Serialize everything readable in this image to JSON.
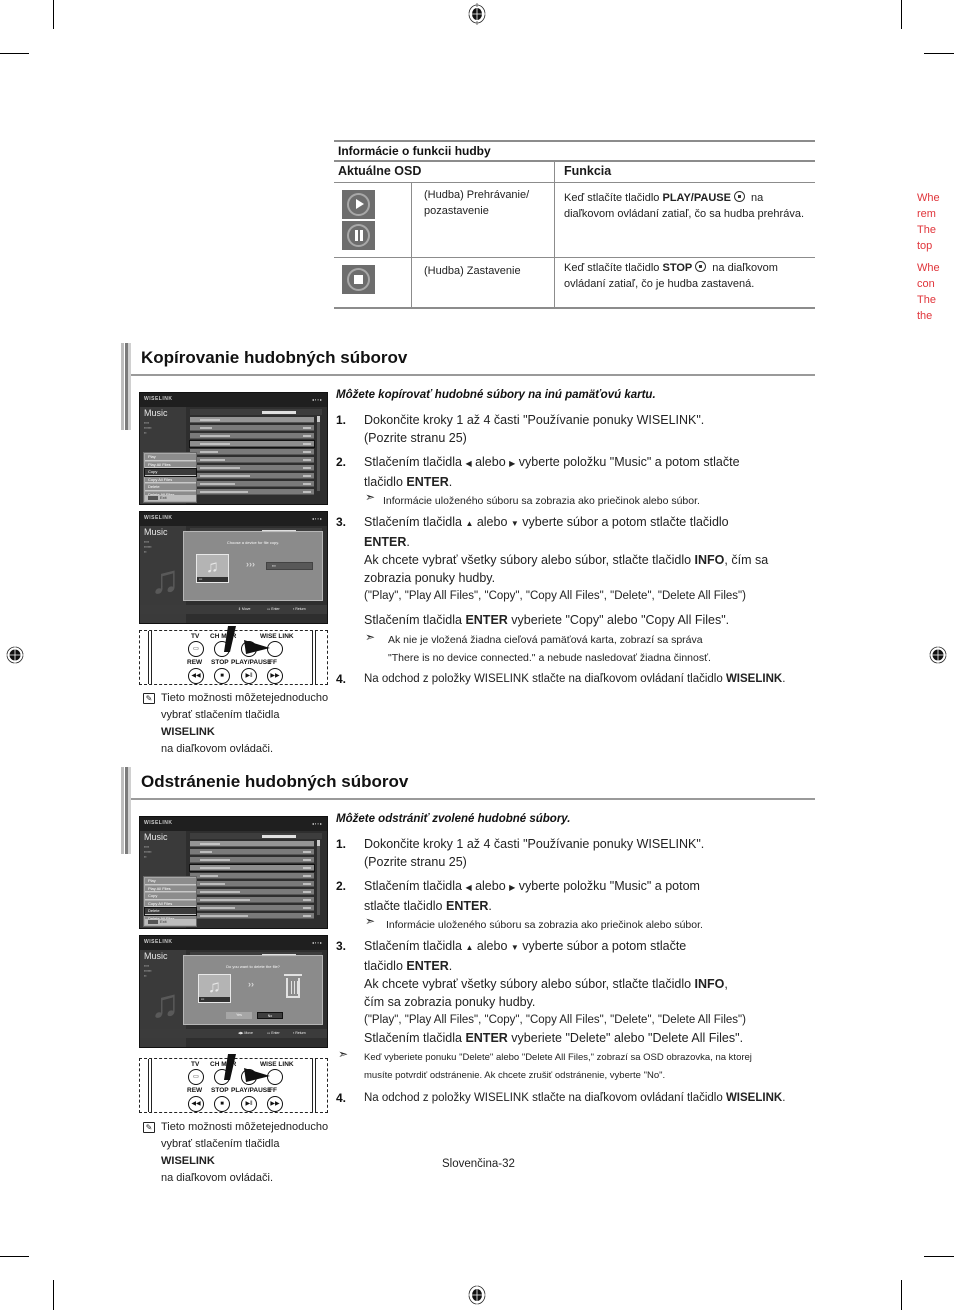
{
  "function_table": {
    "title": "Informácie o funkcii hudby",
    "col_osd": "Aktuálne OSD",
    "col_function": "Funkcia",
    "rows": [
      {
        "icons": [
          "play-icon",
          "pause-icon"
        ],
        "osd": "(Hudba) Prehrávanie/ pozastavenie",
        "osd_line1": "(Hudba) Prehrávanie/",
        "osd_line2": "pozastavenie",
        "func_pre": "Keď stlačíte tlačidlo ",
        "func_key": "PLAY/PAUSE",
        "func_post1": " na",
        "func_line2": "diaľkovom ovládaní zatiaľ, čo sa hudba prehráva."
      },
      {
        "icons": [
          "stop-icon"
        ],
        "osd": "(Hudba) Zastavenie",
        "func_pre": "Keď stlačíte tlačidlo ",
        "func_key": "STOP",
        "func_post1": " na diaľkovom",
        "func_line2": "ovládaní zatiaľ, čo je hudba zastavená."
      }
    ]
  },
  "margin_text": {
    "lines_a": [
      "Whe",
      "rem",
      "The",
      "top"
    ],
    "lines_b": [
      "Whe",
      "con",
      "The",
      "the"
    ],
    "color": "#e0343a"
  },
  "section_copy": {
    "title": "Kopírovanie hudobných súborov",
    "lead": "Môžete kopírovať hudobné súbory na inú pamäťovú kartu.",
    "steps": [
      {
        "num": "1.",
        "line1": "Dokončite kroky 1 až 4 časti \"Používanie ponuky WISELINK\".",
        "line2": "(Pozrite stranu 25)"
      },
      {
        "num": "2.",
        "line1_pre": "Stlačením tlačidla ",
        "line1_mid": " alebo ",
        "line1_post": " vyberte položku \"Music\" a potom stlačte",
        "line2_pre": "tlačidlo ",
        "line2_key": "ENTER",
        "line2_post": ".",
        "tip": "Informácie uloženého súboru sa zobrazia ako priečinok alebo súbor."
      },
      {
        "num": "3.",
        "line1_pre": "Stlačením tlačidla ",
        "line1_mid": " alebo ",
        "line1_post": " vyberte súbor a potom stlačte tlačidlo",
        "line2_key": "ENTER",
        "line2_post": ".",
        "line3_pre": "Ak chcete vybrať všetky súbory alebo súbor, stlačte tlačidlo ",
        "line3_key": "INFO",
        "line3_post": ", čím sa",
        "line4": "zobrazia ponuky hudby.",
        "line5": "(\"Play\", \"Play All Files\", \"Copy\", \"Copy All Files\", \"Delete\", \"Delete All Files\")",
        "line6_pre": "Stlačením tlačidla ",
        "line6_key": "ENTER",
        "line6_post": " vyberiete \"Copy\" alebo \"Copy All Files\".",
        "tip_line1": "Ak nie je vložená žiadna cieľová pamäťová karta, zobrazí sa správa",
        "tip_line2": "\"There is no device connected.\" a nebude nasledovať žiadna činnosť."
      },
      {
        "num": "4.",
        "line1_pre": "Na odchod z položky WISELINK stlačte na diaľkovom ovládaní tlačidlo ",
        "line1_key": "WISELINK",
        "line1_post": "."
      }
    ],
    "note_line1": "Tieto možnosti môžetejednoducho",
    "note_line2_pre": "vybrať stlačením tlačidla ",
    "note_line2_key": "WISELINK",
    "note_line3": "na diaľkovom ovládači."
  },
  "section_delete": {
    "title": "Odstránenie hudobných súborov",
    "lead": "Môžete odstrániť zvolené hudobné súbory.",
    "steps": [
      {
        "num": "1.",
        "line1": "Dokončite kroky 1 až 4 časti \"Používanie ponuky WISELINK\".",
        "line2": "(Pozrite stranu 25)"
      },
      {
        "num": "2.",
        "line1_pre": "Stlačením tlačidla ",
        "line1_mid": " alebo ",
        "line1_post": " vyberte položku \"Music\" a potom",
        "line2_pre": "stlačte tlačidlo ",
        "line2_key": "ENTER",
        "line2_post": ".",
        "tip": "Informácie uloženého súboru sa zobrazia ako priečinok alebo súbor."
      },
      {
        "num": "3.",
        "line1_pre": "Stlačením tlačidla ",
        "line1_mid": " alebo ",
        "line1_post": " vyberte súbor a potom stlačte",
        "line2_pre": "tlačidlo ",
        "line2_key": "ENTER",
        "line2_post": ".",
        "line3_pre": "Ak chcete vybrať všetky súbory alebo súbor, stlačte tlačidlo ",
        "line3_key": "INFO",
        "line3_post": ",",
        "line4": "čím sa zobrazia ponuky hudby.",
        "line5": "(\"Play\", \"Play All Files\", \"Copy\", \"Copy All Files\", \"Delete\", \"Delete All Files\")",
        "line6_pre": "Stlačením tlačidla ",
        "line6_key": "ENTER",
        "line6_post": " vyberiete \"Delete\" alebo \"Delete All Files\".",
        "tip_line1": "Keď vyberiete ponuku \"Delete\" alebo \"Delete All Files,\" zobrazí sa OSD obrazovka, na ktorej",
        "tip_line2": "musíte potvrdiť odstránenie. Ak chcete zrušiť odstránenie, vyberte \"No\"."
      },
      {
        "num": "4.",
        "line1_pre": "Na odchod z položky WISELINK stlačte na diaľkovom ovládaní tlačidlo ",
        "line1_key": "WISELINK",
        "line1_post": "."
      }
    ],
    "note_line1": "Tieto možnosti môžetejednoducho",
    "note_line2_pre": "vybrať stlačením tlačidla ",
    "note_line2_key": "WISELINK",
    "note_line3": "na diaľkovom ovládači."
  },
  "tv_screens": {
    "logo": "WISELINK",
    "section": "Music",
    "menu_items": [
      "Play",
      "Play All Files",
      "Copy",
      "Copy All Files",
      "Delete",
      "Delete All Files"
    ],
    "menu_exit": "Exit",
    "copy_menu_selected": "Copy",
    "delete_menu_selected": "Delete",
    "copy_dialog_title": "Choose a device for file copy.",
    "delete_dialog_title": "Do you want to delete the file?",
    "dialog_yes": "Yes",
    "dialog_no": "No",
    "hint_move": "Move",
    "hint_enter": "Enter",
    "hint_return": "Return"
  },
  "remote": {
    "top_labels": [
      "TV",
      "CH MGR",
      "",
      "WISE LINK"
    ],
    "bottom_labels": [
      "REW",
      "STOP",
      "PLAY/PAUSE",
      "FF"
    ],
    "bottom_glyphs": [
      "◀◀",
      "■",
      "▶‖",
      "▶▶"
    ]
  },
  "footer": {
    "page_label": "Slovenčina-32"
  }
}
